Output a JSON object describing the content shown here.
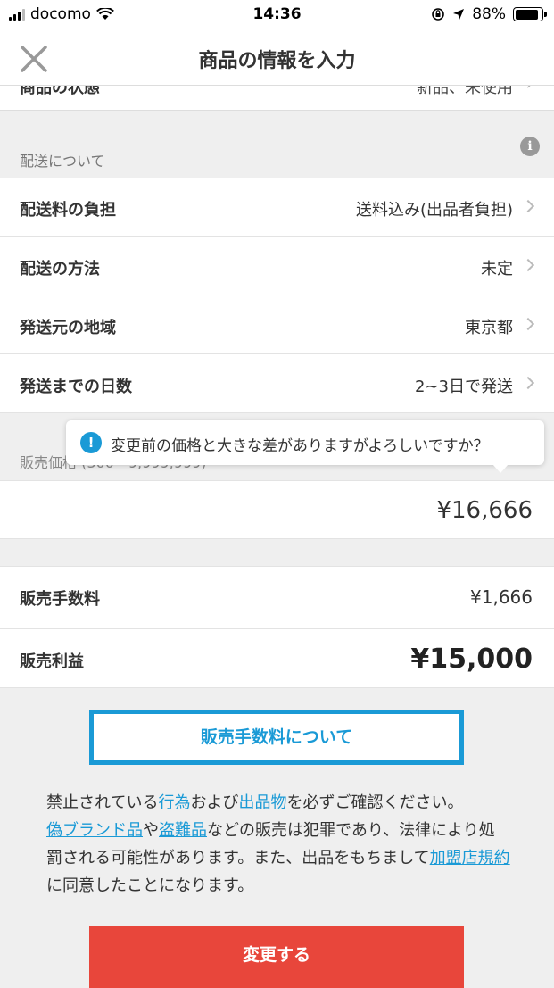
{
  "status_bar": {
    "carrier": "docomo",
    "time": "14:36",
    "battery": "88%",
    "battery_level": 0.88
  },
  "nav": {
    "title": "商品の情報を入力",
    "close_icon": "close-icon"
  },
  "condition_row": {
    "label": "商品の状態",
    "value": "新品、未使用"
  },
  "shipping": {
    "section_label": "配送について",
    "info_icon": "info-icon",
    "rows": [
      {
        "label": "配送料の負担",
        "value": "送料込み(出品者負担)"
      },
      {
        "label": "配送の方法",
        "value": "未定"
      },
      {
        "label": "発送元の地域",
        "value": "東京都"
      },
      {
        "label": "発送までの日数",
        "value": "2~3日で発送"
      }
    ]
  },
  "price": {
    "section_label": "販売価格 (300〜9,999,999)",
    "value": "¥16,666",
    "tooltip": "変更前の価格と大きな差がありますがよろしいですか？"
  },
  "fees": {
    "fee_label": "販売手数料",
    "fee_value": "¥1,666",
    "profit_label": "販売利益",
    "profit_value": "¥15,000"
  },
  "fee_button_label": "販売手数料について",
  "notice": {
    "t1": "禁止されている",
    "l1": "行為",
    "t2": "および",
    "l2": "出品物",
    "t3": "を必ずご確認ください。",
    "l3": "偽ブランド品",
    "t4": "や",
    "l4": "盗難品",
    "t5": "などの販売は犯罪であり、法律により処罰される可能性があります。また、出品をもちまして",
    "l5": "加盟店規約",
    "t6": "に同意したことになります。"
  },
  "submit_label": "変更する",
  "colors": {
    "accent": "#1a9ad6",
    "submit": "#e8463b",
    "background": "#efefef"
  }
}
